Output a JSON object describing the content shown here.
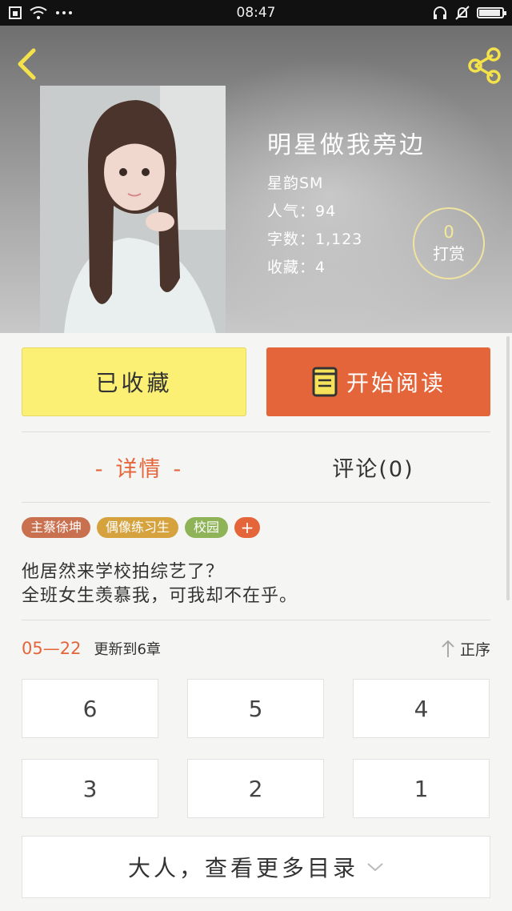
{
  "status_bar": {
    "time": "08:47",
    "icons_left": [
      "sim-icon",
      "wifi-icon",
      "more-dots-icon"
    ],
    "icons_right": [
      "headphones-icon",
      "mute-icon",
      "battery-icon"
    ],
    "battery_level": 0.9
  },
  "book": {
    "title": "明星做我旁边",
    "author": "星韵SM",
    "popularity": "人气：94",
    "word_count": "字数：1,123",
    "favorites": "收藏：4"
  },
  "reward": {
    "count": "0",
    "label": "打赏"
  },
  "actions": {
    "collected_label": "已收藏",
    "read_label": "开始阅读"
  },
  "tabs": [
    {
      "label": "详情",
      "dash_left": "-",
      "dash_right": "-"
    },
    {
      "label": "评论(0)"
    }
  ],
  "tags": [
    {
      "label": "主蔡徐坤",
      "color": "#c9704f"
    },
    {
      "label": "偶像练习生",
      "color": "#d5a23d"
    },
    {
      "label": "校园",
      "color": "#8fb457"
    }
  ],
  "tag_add_label": "+",
  "description": [
    "他居然来学校拍综艺了？",
    "全班女生羡慕我，可我却不在乎。"
  ],
  "update": {
    "date": "05—22",
    "text": "更新到6章",
    "order_label": "正序"
  },
  "chapters": [
    "6",
    "5",
    "4",
    "3",
    "2",
    "1"
  ],
  "more_catalog_label": "大人，查看更多目录",
  "colors": {
    "accent": "#e5653a",
    "collected_bg": "#fbf074",
    "reward_ring": "#efe3a0"
  }
}
